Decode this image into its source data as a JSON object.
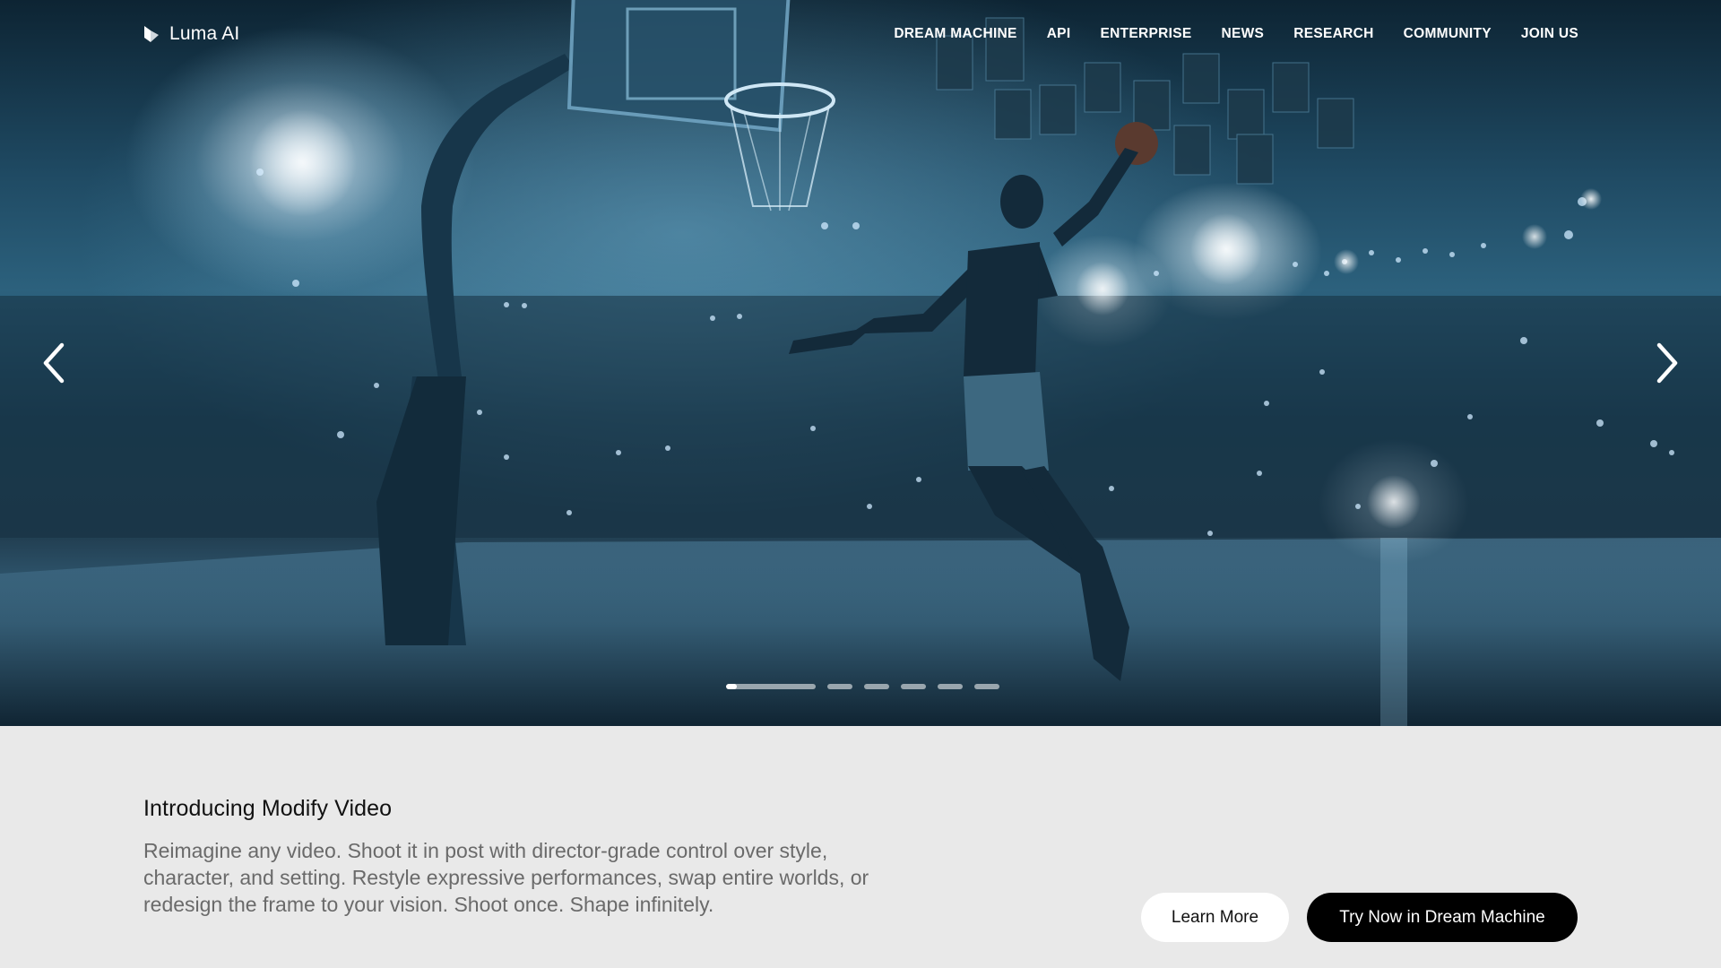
{
  "brand": {
    "name": "Luma AI",
    "logo_icon": "luma-cube-icon"
  },
  "nav": {
    "items": [
      "DREAM MACHINE",
      "API",
      "ENTERPRISE",
      "NEWS",
      "RESEARCH",
      "COMMUNITY",
      "JOIN US"
    ]
  },
  "hero": {
    "image_subject": "basketball-dunk-arena",
    "prev_icon": "chevron-left-icon",
    "next_icon": "chevron-right-icon",
    "slides": {
      "count": 6,
      "active_index": 0,
      "active_progress": 0.12
    }
  },
  "intro": {
    "title": "Introducing Modify Video",
    "description": "Reimagine any video. Shoot it in post with director-grade control over style, character, and setting. Restyle expressive performances, swap entire worlds, or redesign the frame to your vision. Shoot once. Shape infinitely."
  },
  "actions": {
    "learn_more": "Learn More",
    "try_now": "Try Now in Dream Machine"
  },
  "colors": {
    "page_bg": "#e9e9e9",
    "primary_button_bg": "#000000",
    "secondary_button_bg": "#ffffff",
    "description_text": "#6a6a6a"
  }
}
